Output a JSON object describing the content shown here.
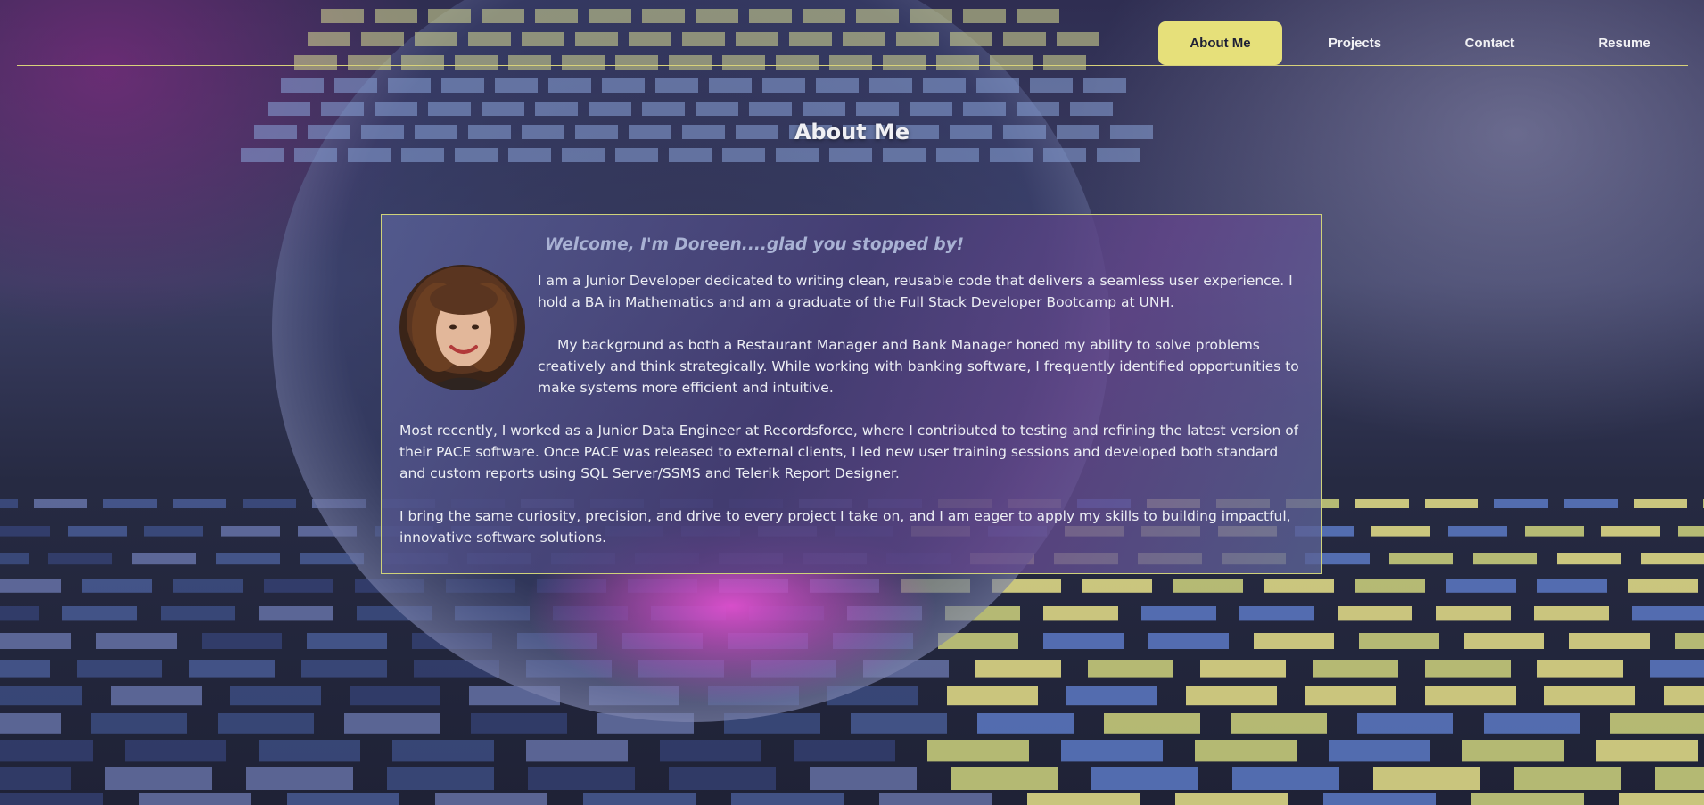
{
  "nav": {
    "items": [
      {
        "label": "About Me",
        "active": true
      },
      {
        "label": "Projects",
        "active": false
      },
      {
        "label": "Contact",
        "active": false
      },
      {
        "label": "Resume",
        "active": false
      }
    ]
  },
  "about": {
    "title": "About Me",
    "welcome": "Welcome, I'm Doreen....glad you stopped by!",
    "paragraphs": [
      "I am a Junior Developer dedicated to writing clean, reusable code that delivers a seamless user experience. I hold a BA in Mathematics and am a graduate of the Full Stack Developer Bootcamp at UNH.",
      "My background as both a Restaurant Manager and Bank Manager honed my ability to solve problems creatively and think strategically. While working with banking software, I frequently identified opportunities to make systems more efficient and intuitive.",
      "Most recently, I worked as a Junior Data Engineer at Recordsforce, where I contributed to testing and refining the latest version of their PACE software. Once PACE was released to external clients, I led new user training sessions and developed both standard and custom reports using SQL Server/SSMS and Telerik Report Designer.",
      "I bring the same curiosity, precision, and drive to every project I take on, and I am eager to apply my skills to building impactful, innovative software solutions."
    ]
  },
  "colors": {
    "accent": "#e6e07a",
    "rule": "#d8d27a",
    "welcome_text": "#a9b2d4"
  }
}
